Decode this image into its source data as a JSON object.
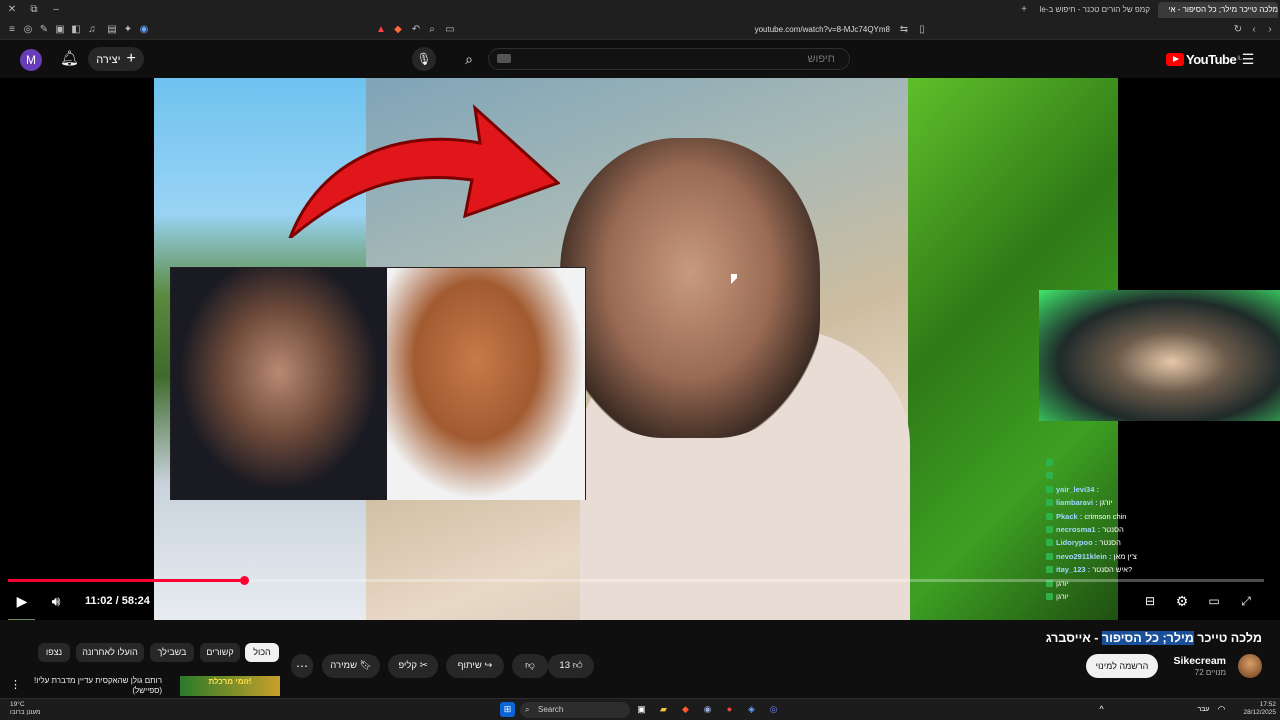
{
  "browser": {
    "tabs": [
      {
        "label": "מלכה טייכר מילר; כל הסיפור - אי",
        "active": true
      },
      {
        "label": "קמפ של הורים טכנר - חיפוש ב-Google",
        "active": false
      }
    ],
    "url": "youtube.com/watch?v=8-MJc74QYm8"
  },
  "header": {
    "avatar_letter": "M",
    "create_label": "יצירה",
    "search_placeholder": "חיפוש",
    "logo_text": "YouTube",
    "logo_region": "IL"
  },
  "player": {
    "current_time": "11:02",
    "duration": "58:24",
    "progress_fraction": 0.188,
    "chat": [
      {
        "user": "",
        "text": ""
      },
      {
        "user": "",
        "text": ""
      },
      {
        "user": "yair_levi34 :",
        "text": ""
      },
      {
        "user": "liambaravi :",
        "text": "יורגן"
      },
      {
        "user": "Pkack :",
        "text": "crimson chin"
      },
      {
        "user": "necrosma1 :",
        "text": "הסנטר"
      },
      {
        "user": "Lidorypoo :",
        "text": "הסנטר"
      },
      {
        "user": "nevo2911klein :",
        "text": "צ'ין מאן"
      },
      {
        "user": "itay_123 :",
        "text": "איש הסנטר?"
      },
      {
        "user": "",
        "text": "יורגן"
      },
      {
        "user": "",
        "text": "יורגן"
      }
    ]
  },
  "video": {
    "title_plain": "מלכה טייכר ",
    "title_highlight": "מילר; כל הסיפור",
    "title_rest": " - אייסברג",
    "channel_name": "Sikecream",
    "subscribers": "72 מנויים",
    "subscribe_label": "הרשמה למינוי",
    "like_count": "13",
    "share_label": "שיתוף",
    "clip_label": "קליפ",
    "save_label": "שמירה"
  },
  "chips": [
    "הכול",
    "קשורים",
    "בשבילך",
    "הועלו לאחרונה",
    "נצפו"
  ],
  "recommended": {
    "title": "רותם גולן שהאקסית עדיין מדברת עליו! (ספיישל)",
    "thumb_text": "זומי מרכלת!"
  },
  "taskbar": {
    "search_label": "Search",
    "time": "17:52",
    "date": "28/12/2025",
    "weather": "19°C",
    "weather_desc": "מעונן ברובו",
    "lang": "עבר"
  },
  "colors": {
    "accent_red": "#ff0033",
    "highlight_blue": "#1a4f9a",
    "chat_badge_green": "#2fb24a"
  }
}
